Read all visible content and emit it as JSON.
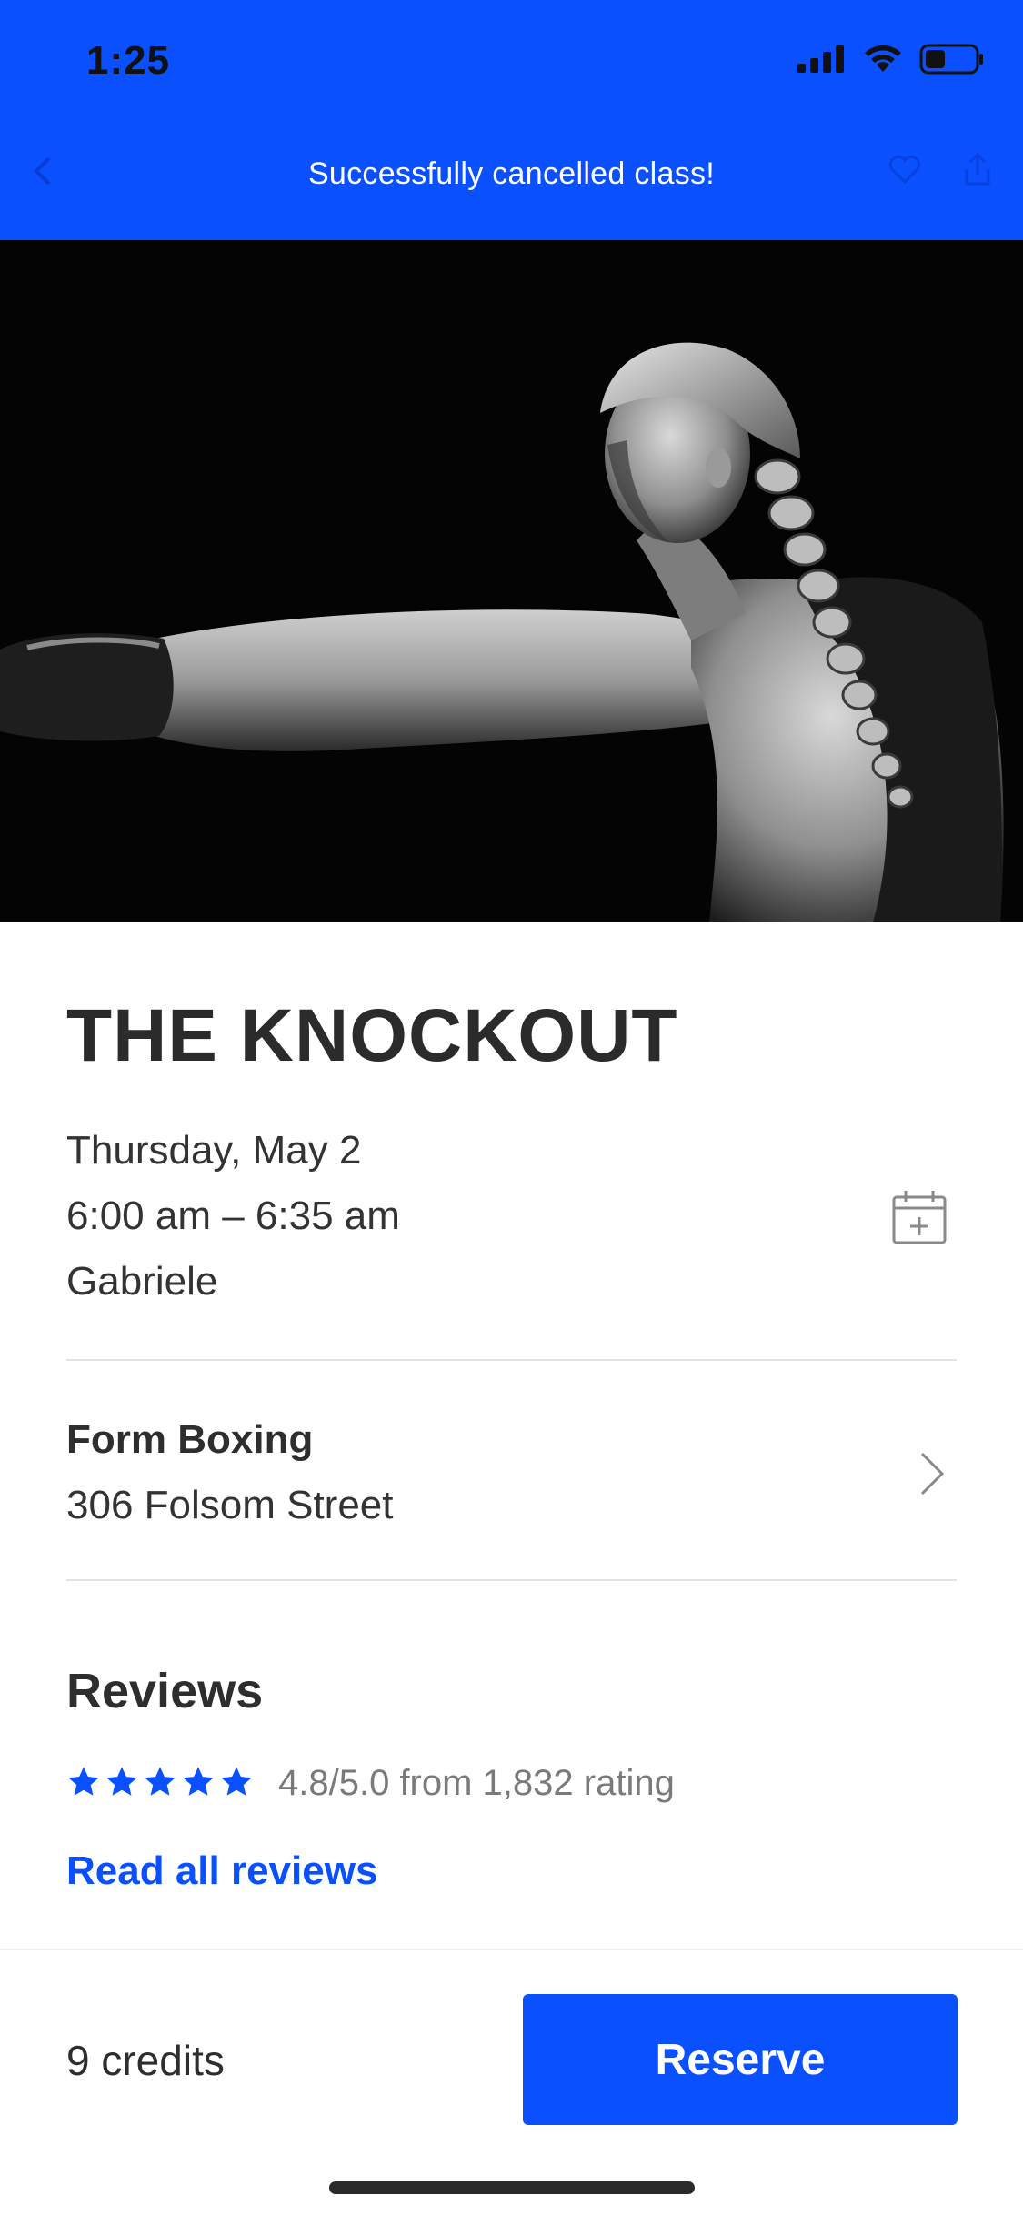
{
  "status_bar": {
    "time": "1:25",
    "battery_level": 0.4
  },
  "toast": {
    "message": "Successfully cancelled class!"
  },
  "hero": {
    "alt": "boxer"
  },
  "class_info": {
    "title": "THE KNOCKOUT",
    "date": "Thursday, May 2",
    "time_range": "6:00 am – 6:35 am",
    "instructor": "Gabriele"
  },
  "studio": {
    "name": "Form Boxing",
    "address": "306 Folsom Street"
  },
  "reviews": {
    "heading": "Reviews",
    "stars": 5,
    "rating_text": "4.8/5.0 from 1,832 rating",
    "read_all_label": "Read all reviews"
  },
  "footer": {
    "credits": "9 credits",
    "reserve_label": "Reserve"
  },
  "colors": {
    "accent": "#0a50ff",
    "text": "#2e2e2e",
    "muted": "#7a7a7a"
  },
  "icons": [
    "signal-icon",
    "wifi-icon",
    "battery-icon",
    "calendar-add-icon",
    "chevron-right-icon",
    "star-icon"
  ]
}
